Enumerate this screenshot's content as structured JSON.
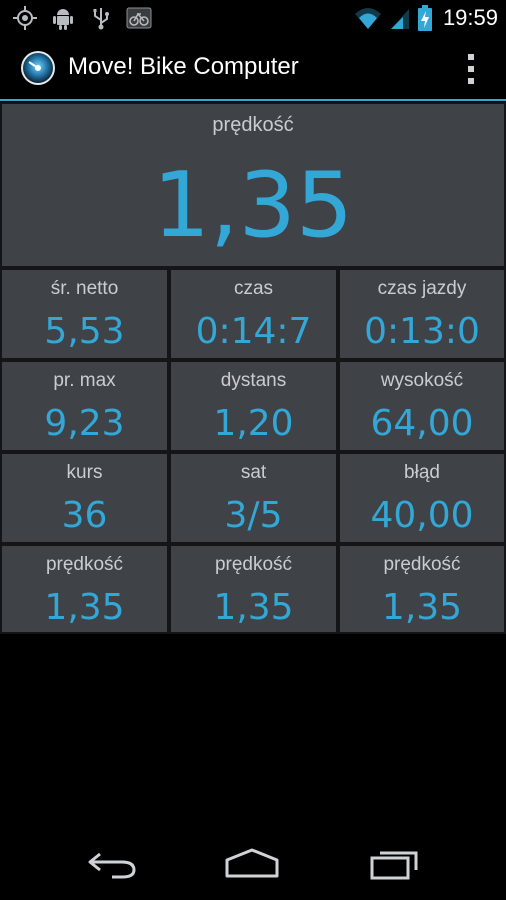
{
  "status_bar": {
    "time": "19:59",
    "icons": [
      "gps-icon",
      "android-debug-icon",
      "usb-icon",
      "bike-notification-icon",
      "wifi-icon",
      "signal-icon",
      "battery-charging-icon"
    ]
  },
  "action_bar": {
    "title": "Move! Bike Computer",
    "logo_icon": "speedometer-logo-icon",
    "overflow_icon": "overflow-menu-icon"
  },
  "main_tile": {
    "label": "prędkość",
    "value": "1,35"
  },
  "tiles": [
    {
      "label": "śr. netto",
      "value": "5,53"
    },
    {
      "label": "czas",
      "value": "0:14:7"
    },
    {
      "label": "czas jazdy",
      "value": "0:13:0"
    },
    {
      "label": "pr. max",
      "value": "9,23"
    },
    {
      "label": "dystans",
      "value": "1,20"
    },
    {
      "label": "wysokość",
      "value": "64,00"
    },
    {
      "label": "kurs",
      "value": "36"
    },
    {
      "label": "sat",
      "value": "3/5"
    },
    {
      "label": "błąd",
      "value": "40,00"
    },
    {
      "label": "prędkość",
      "value": "1,35"
    },
    {
      "label": "prędkość",
      "value": "1,35"
    },
    {
      "label": "prędkość",
      "value": "1,35"
    }
  ],
  "nav_bar": {
    "buttons": [
      "back-icon",
      "home-icon",
      "recent-apps-icon"
    ]
  },
  "colors": {
    "accent": "#33a7d6",
    "tile_bg": "#3f4247",
    "tile_border": "#141516",
    "background": "#000000"
  }
}
